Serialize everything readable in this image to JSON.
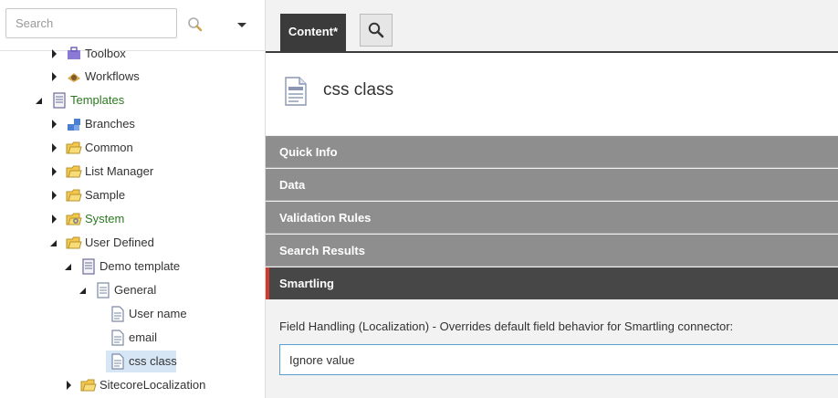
{
  "search": {
    "placeholder": "Search"
  },
  "tree": {
    "items": [
      {
        "label": "Toolbox",
        "expander": "collapsed",
        "icon": "toolbox-icon"
      },
      {
        "label": "Workflows",
        "expander": "collapsed",
        "icon": "workflow-icon"
      },
      {
        "label": "Templates",
        "expander": "expanded",
        "icon": "template-icon"
      },
      {
        "label": "Branches",
        "expander": "collapsed",
        "icon": "branch-icon"
      },
      {
        "label": "Common",
        "expander": "collapsed",
        "icon": "folder-icon"
      },
      {
        "label": "List Manager",
        "expander": "collapsed",
        "icon": "folder-icon"
      },
      {
        "label": "Sample",
        "expander": "collapsed",
        "icon": "folder-icon"
      },
      {
        "label": "System",
        "expander": "collapsed",
        "icon": "system-folder-icon"
      },
      {
        "label": "User Defined",
        "expander": "expanded",
        "icon": "folder-icon"
      },
      {
        "label": "Demo template",
        "expander": "expanded",
        "icon": "template-icon"
      },
      {
        "label": "General",
        "expander": "expanded",
        "icon": "section-icon"
      },
      {
        "label": "User name",
        "expander": "none",
        "icon": "field-icon"
      },
      {
        "label": "email",
        "expander": "none",
        "icon": "field-icon"
      },
      {
        "label": "css class",
        "expander": "none",
        "icon": "field-icon",
        "selected": true
      },
      {
        "label": "SitecoreLocalization",
        "expander": "collapsed",
        "icon": "folder-icon"
      }
    ]
  },
  "tabs": {
    "content_label": "Content*"
  },
  "item": {
    "title": "css class",
    "icon": "field-icon"
  },
  "sections": [
    {
      "label": "Quick Info"
    },
    {
      "label": "Data"
    },
    {
      "label": "Validation Rules"
    },
    {
      "label": "Search Results"
    },
    {
      "label": "Smartling",
      "active": true
    }
  ],
  "field": {
    "label": "Field Handling (Localization) - Overrides default field behavior for Smartling connector:",
    "value": "Ignore value"
  },
  "colors": {
    "accent": "#d23b2b",
    "tab_dark": "#3b3b3b",
    "section_gray": "#8e8e8e",
    "green_text": "#2a7a1f",
    "selection": "#d6e6f5"
  }
}
